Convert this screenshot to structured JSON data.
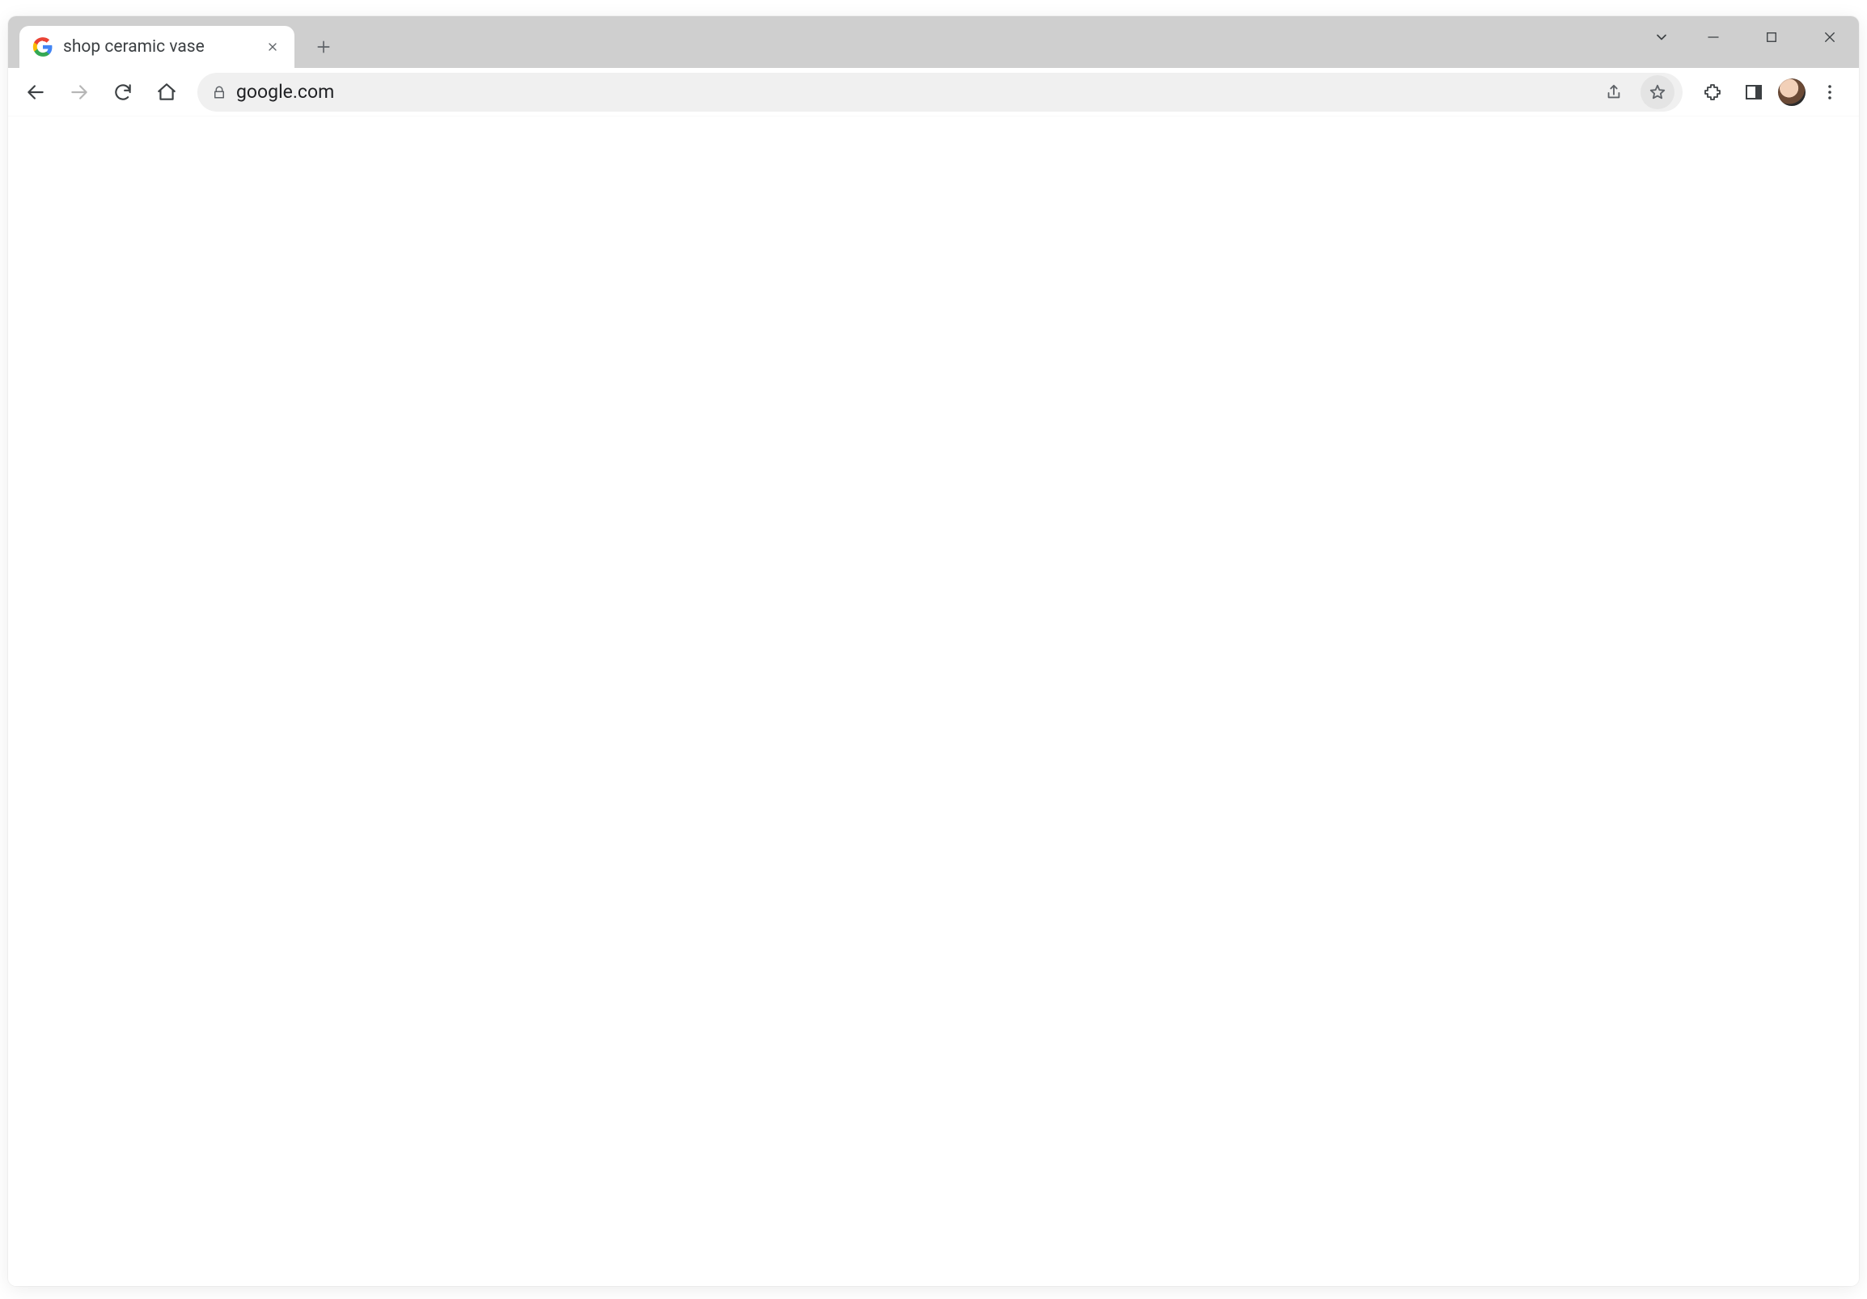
{
  "browser": {
    "tabs": [
      {
        "title": "shop ceramic vase",
        "favicon": "google"
      }
    ],
    "window_controls": {
      "search_tabs": "Search tabs",
      "minimize": "Minimize",
      "maximize": "Maximize",
      "close": "Close"
    },
    "new_tab_label": "New Tab"
  },
  "toolbar": {
    "back_label": "Back",
    "forward_label": "Forward",
    "reload_label": "Reload",
    "home_label": "Home",
    "url": "google.com",
    "site_info_label": "View site information",
    "share_label": "Share this page",
    "bookmark_label": "Bookmark this tab",
    "extensions_label": "Extensions",
    "sidepanel_label": "Side panel",
    "profile_label": "Profile",
    "menu_label": "Customize and control Google Chrome"
  }
}
